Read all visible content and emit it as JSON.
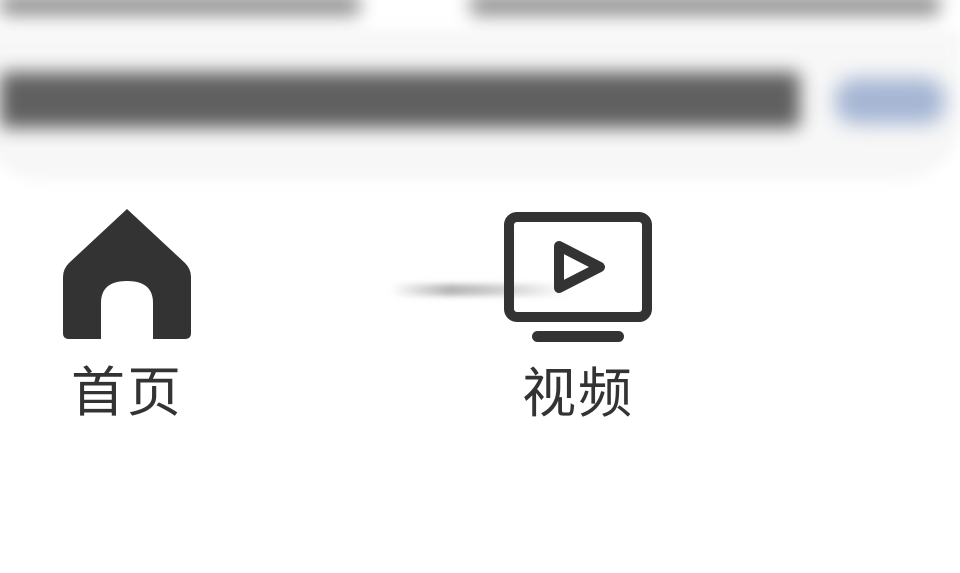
{
  "bottom_nav": {
    "items": [
      {
        "label": "首页",
        "icon": "home-icon",
        "selected": true
      },
      {
        "label": "视频",
        "icon": "tv-play-icon",
        "selected": false
      }
    ]
  },
  "colors": {
    "icon": "#333333",
    "label": "#333333",
    "background": "#ffffff"
  }
}
